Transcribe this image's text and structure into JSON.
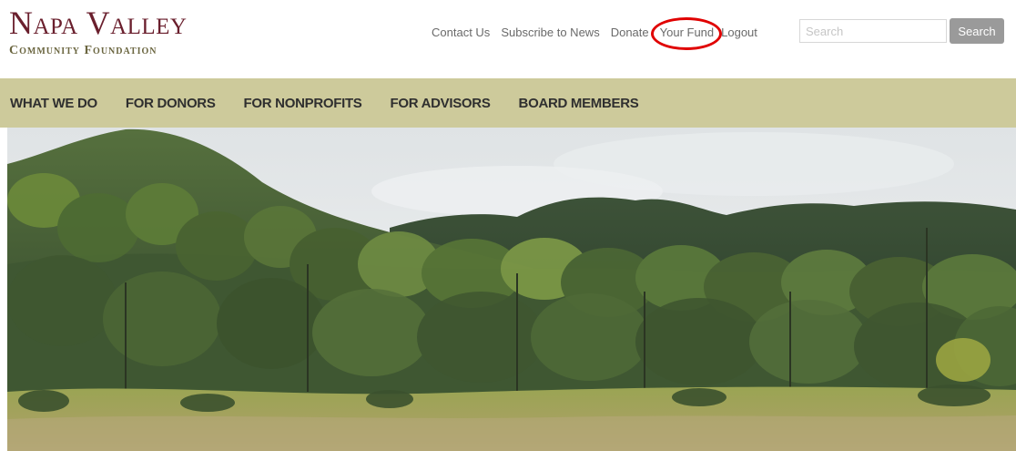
{
  "logo": {
    "line1": "Napa Valley",
    "line2": "Community Foundation"
  },
  "utility_nav": [
    {
      "label": "Contact Us"
    },
    {
      "label": "Subscribe to News"
    },
    {
      "label": "Donate"
    },
    {
      "label": "Your Fund",
      "highlighted": true
    },
    {
      "label": "Logout"
    }
  ],
  "search": {
    "placeholder": "Search",
    "value": "",
    "button_label": "Search"
  },
  "main_nav": [
    {
      "label": "WHAT WE DO"
    },
    {
      "label": "FOR DONORS"
    },
    {
      "label": "FOR NONPROFITS"
    },
    {
      "label": "FOR ADVISORS"
    },
    {
      "label": "BOARD MEMBERS"
    }
  ],
  "colors": {
    "brand": "#6a1f2d",
    "logo_subtitle": "#6b6640",
    "nav_bar": "#cdca9b",
    "nav_text": "#2f2f2f",
    "utility_text": "#6a6a6a",
    "search_button": "#9a9a9a",
    "highlight_ring": "#e00000"
  },
  "hero": {
    "image": "hillside-oak-woodland-photo"
  }
}
